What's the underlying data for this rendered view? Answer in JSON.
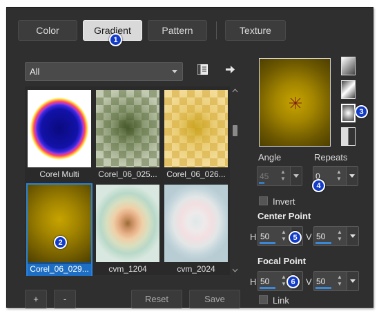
{
  "tabs": [
    {
      "label": "Color",
      "active": false
    },
    {
      "label": "Gradient",
      "active": true
    },
    {
      "label": "Pattern",
      "active": false
    },
    {
      "label": "Texture",
      "active": false
    }
  ],
  "library_select": {
    "value": "All"
  },
  "thumbnails": [
    {
      "label": "Corel Multi",
      "selected": false
    },
    {
      "label": "Corel_06_025...",
      "selected": false
    },
    {
      "label": "Corel_06_026...",
      "selected": false
    },
    {
      "label": "Corel_06_029...",
      "selected": true
    },
    {
      "label": "cvm_1204",
      "selected": false
    },
    {
      "label": "cvm_2024",
      "selected": false
    }
  ],
  "buttons": {
    "add": "+",
    "remove": "-",
    "reset": "Reset",
    "save": "Save"
  },
  "angle": {
    "label": "Angle",
    "value": "45"
  },
  "repeats": {
    "label": "Repeats",
    "value": "0"
  },
  "invert": {
    "label": "Invert",
    "checked": false
  },
  "center_point": {
    "label": "Center Point",
    "h_label": "H",
    "h": "50",
    "v_label": "V",
    "v": "50"
  },
  "focal_point": {
    "label": "Focal Point",
    "h_label": "H",
    "h": "50",
    "v_label": "V",
    "v": "50"
  },
  "link": {
    "label": "Link",
    "checked": false
  },
  "callouts": [
    "1",
    "2",
    "3",
    "4",
    "5",
    "6"
  ],
  "colors": {
    "accent": "#123cc8",
    "selection": "#1e6fc3",
    "gradient_center": "#c7a400",
    "gradient_edge": "#4d3f00"
  }
}
